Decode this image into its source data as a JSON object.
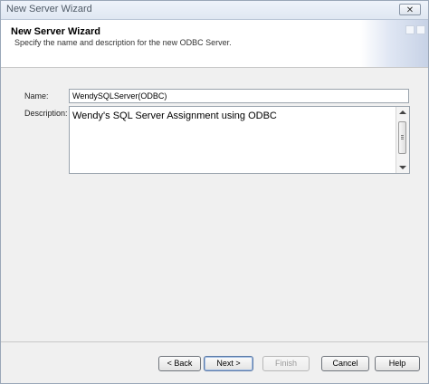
{
  "window": {
    "title": "New Server Wizard",
    "close_glyph": "✕"
  },
  "header": {
    "title": "New Server Wizard",
    "subtitle": "Specify the name and description for the new ODBC Server."
  },
  "form": {
    "name_label": "Name:",
    "name_value": "WendySQLServer(ODBC)",
    "description_label": "Description:",
    "description_value": "Wendy's SQL Server Assignment using ODBC"
  },
  "buttons": {
    "back": "< Back",
    "next": "Next >",
    "finish": "Finish",
    "cancel": "Cancel",
    "help": "Help"
  }
}
